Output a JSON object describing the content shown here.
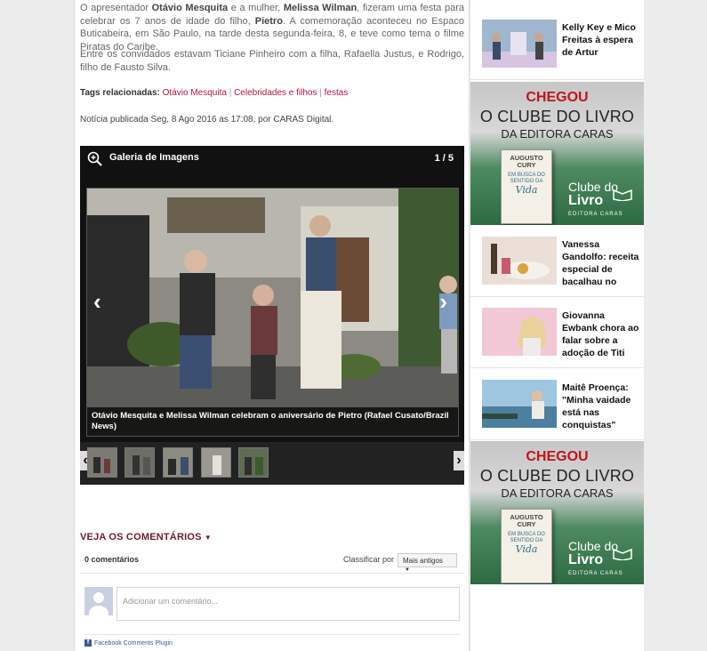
{
  "article": {
    "p1": {
      "s1": "O apresentador ",
      "b1": "Otávio Mesquita",
      "s2": " e a mulher, ",
      "b2": "Melissa Wilman",
      "s3": ", fizeram uma festa para celebrar os 7 anos de idade do filho, ",
      "b3": "Pietro",
      "s4": ". A comemoração aconteceu no Espaco Buticabeira, em São Paulo, na tarde desta segunda-feira, 8, e teve como tema o filme Piratas do Caribe."
    },
    "p2": "Entre os convidados estavam Ticiane Pinheiro com a filha, Rafaella Justus, e Rodrigo, filho de Fausto Silva.",
    "tags_label": "Tags relacionadas:",
    "tags": [
      "Otávio Mesquita",
      "Celebridades e filhos",
      "festas"
    ],
    "tag_sep": "|",
    "published": "Notícia publicada Seg, 8 Ago 2016 as 17:08, por CARAS Digital."
  },
  "gallery": {
    "title": "Galeria de Imagens",
    "counter": "1 / 5",
    "prev_arrow": "‹",
    "next_arrow": "›",
    "caption": "Otávio Mesquita e Melissa Wilman celebram o aniversário de Pietro (Rafael Cusato/Brazil News)",
    "strip_prev": "‹",
    "strip_next": "›",
    "thumb_count": 5
  },
  "comments": {
    "header": "VEJA OS COMENTÁRIOS",
    "arrow": "▼",
    "count": "0 comentários",
    "sort_label": "Classificar por",
    "sort_value": "Mais antigos",
    "sort_arrow": "▼",
    "input_placeholder": "Adicionar um comentário...",
    "plugin": "Facebook Comments Plugin",
    "plugin_icon": "f"
  },
  "sidebar": {
    "news": [
      {
        "title": "Kelly Key e Mico Freitas à espera de Artur"
      },
      {
        "title": "Vanessa Gandolfo: receita especial de bacalhau no"
      },
      {
        "title": "Giovanna Ewbank chora ao falar sobre a adoção de Titi"
      },
      {
        "title": "Maitê Proença: \"Minha vaidade está nas conquistas\""
      }
    ],
    "ad": {
      "chegou": "CHEGOU",
      "clube": "O CLUBE DO LIVRO",
      "editora": "DA EDITORA CARAS",
      "book_author": "AUGUSTO CURY",
      "book_title": "EM BUSCA DO SENTIDO DA",
      "book_vida": "Vida",
      "logo_clube": "Clube do",
      "logo_livro": "Livro",
      "logo_editora": "EDITORA CARAS"
    }
  }
}
